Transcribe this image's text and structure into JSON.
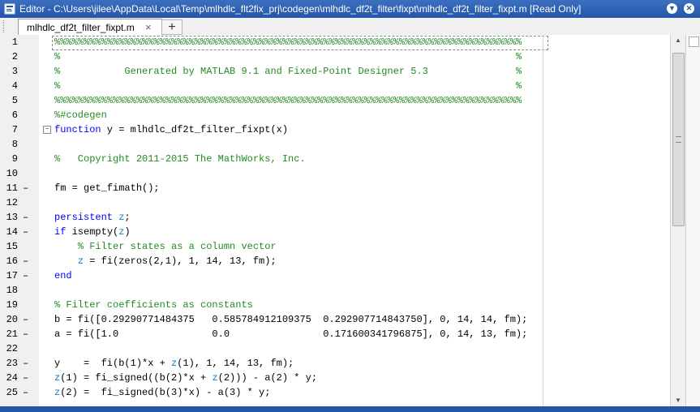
{
  "window": {
    "title": "Editor - C:\\Users\\jilee\\AppData\\Local\\Temp\\mlhdlc_flt2fix_prj\\codegen\\mlhdlc_df2t_filter\\fixpt\\mlhdlc_df2t_filter_fixpt.m [Read Only]",
    "menu_icon": "chevron-down-circle-icon",
    "close_icon": "close-circle-icon"
  },
  "tabs": [
    {
      "label": "mlhdlc_df2t_filter_fixpt.m",
      "close": "×",
      "active": true
    }
  ],
  "add_tab_label": "+",
  "colors": {
    "keyword": "#0000ff",
    "comment": "#228b22",
    "variable": "#0e7fbf",
    "titlebar": "#2456a8"
  },
  "lines": [
    {
      "num": "1",
      "mark": "",
      "fold": "",
      "tokens": [
        {
          "t": "%%%%%%%%%%%%%%%%%%%%%%%%%%%%%%%%%%%%%%%%%%%%%%%%%%%%%%%%%%%%%%%%%%%%%%%%%%%%%%%%",
          "c": "c"
        }
      ]
    },
    {
      "num": "2",
      "mark": "",
      "fold": "",
      "tokens": [
        {
          "t": "%                                                                              %",
          "c": "c"
        }
      ]
    },
    {
      "num": "3",
      "mark": "",
      "fold": "",
      "tokens": [
        {
          "t": "%           Generated by MATLAB 9.1 and Fixed-Point Designer 5.3               %",
          "c": "c"
        }
      ]
    },
    {
      "num": "4",
      "mark": "",
      "fold": "",
      "tokens": [
        {
          "t": "%                                                                              %",
          "c": "c"
        }
      ]
    },
    {
      "num": "5",
      "mark": "",
      "fold": "",
      "tokens": [
        {
          "t": "%%%%%%%%%%%%%%%%%%%%%%%%%%%%%%%%%%%%%%%%%%%%%%%%%%%%%%%%%%%%%%%%%%%%%%%%%%%%%%%%",
          "c": "c"
        }
      ]
    },
    {
      "num": "6",
      "mark": "",
      "fold": "",
      "tokens": [
        {
          "t": "%#codegen",
          "c": "c"
        }
      ]
    },
    {
      "num": "7",
      "mark": "",
      "fold": "−",
      "tokens": [
        {
          "t": "function",
          "c": "k"
        },
        {
          "t": " y = mlhdlc_df2t_filter_fixpt(x)",
          "c": ""
        }
      ]
    },
    {
      "num": "8",
      "mark": "",
      "fold": "",
      "tokens": []
    },
    {
      "num": "9",
      "mark": "",
      "fold": "",
      "tokens": [
        {
          "t": "%   Copyright 2011-2015 The MathWorks, Inc.",
          "c": "c"
        }
      ]
    },
    {
      "num": "10",
      "mark": "",
      "fold": "",
      "tokens": []
    },
    {
      "num": "11",
      "mark": "–",
      "fold": "",
      "tokens": [
        {
          "t": "fm = get_fimath();",
          "c": ""
        }
      ]
    },
    {
      "num": "12",
      "mark": "",
      "fold": "",
      "tokens": []
    },
    {
      "num": "13",
      "mark": "–",
      "fold": "",
      "tokens": [
        {
          "t": "persistent",
          "c": "k"
        },
        {
          "t": " ",
          "c": ""
        },
        {
          "t": "z",
          "c": "v"
        },
        {
          "t": ";",
          "c": ""
        }
      ]
    },
    {
      "num": "14",
      "mark": "–",
      "fold": "",
      "tokens": [
        {
          "t": "if",
          "c": "k"
        },
        {
          "t": " isempty(",
          "c": ""
        },
        {
          "t": "z",
          "c": "v"
        },
        {
          "t": ")",
          "c": ""
        }
      ]
    },
    {
      "num": "15",
      "mark": "",
      "fold": "",
      "tokens": [
        {
          "t": "    % Filter states as a column vector",
          "c": "c"
        }
      ]
    },
    {
      "num": "16",
      "mark": "–",
      "fold": "",
      "tokens": [
        {
          "t": "    ",
          "c": ""
        },
        {
          "t": "z",
          "c": "v"
        },
        {
          "t": " = fi(zeros(2,1), 1, 14, 13, fm);",
          "c": ""
        }
      ]
    },
    {
      "num": "17",
      "mark": "–",
      "fold": "",
      "tokens": [
        {
          "t": "end",
          "c": "k"
        }
      ]
    },
    {
      "num": "18",
      "mark": "",
      "fold": "",
      "tokens": []
    },
    {
      "num": "19",
      "mark": "",
      "fold": "",
      "tokens": [
        {
          "t": "% Filter coefficients as constants",
          "c": "c"
        }
      ]
    },
    {
      "num": "20",
      "mark": "–",
      "fold": "",
      "tokens": [
        {
          "t": "b = fi([0.29290771484375   0.585784912109375  0.292907714843750], 0, 14, 14, fm);",
          "c": ""
        }
      ]
    },
    {
      "num": "21",
      "mark": "–",
      "fold": "",
      "tokens": [
        {
          "t": "a = fi([1.0                0.0                0.171600341796875], 0, 14, 13, fm);",
          "c": ""
        }
      ]
    },
    {
      "num": "22",
      "mark": "",
      "fold": "",
      "tokens": []
    },
    {
      "num": "23",
      "mark": "–",
      "fold": "",
      "tokens": [
        {
          "t": "y    =  fi(b(1)*x + ",
          "c": ""
        },
        {
          "t": "z",
          "c": "v"
        },
        {
          "t": "(1), 1, 14, 13, fm);",
          "c": ""
        }
      ]
    },
    {
      "num": "24",
      "mark": "–",
      "fold": "",
      "tokens": [
        {
          "t": "z",
          "c": "v"
        },
        {
          "t": "(1) = fi_signed((b(2)*x + ",
          "c": ""
        },
        {
          "t": "z",
          "c": "v"
        },
        {
          "t": "(2))) - a(2) * y;",
          "c": ""
        }
      ]
    },
    {
      "num": "25",
      "mark": "–",
      "fold": "",
      "tokens": [
        {
          "t": "z",
          "c": "v"
        },
        {
          "t": "(2) =  fi_signed(b(3)*x) - a(3) * y;",
          "c": ""
        }
      ]
    }
  ]
}
